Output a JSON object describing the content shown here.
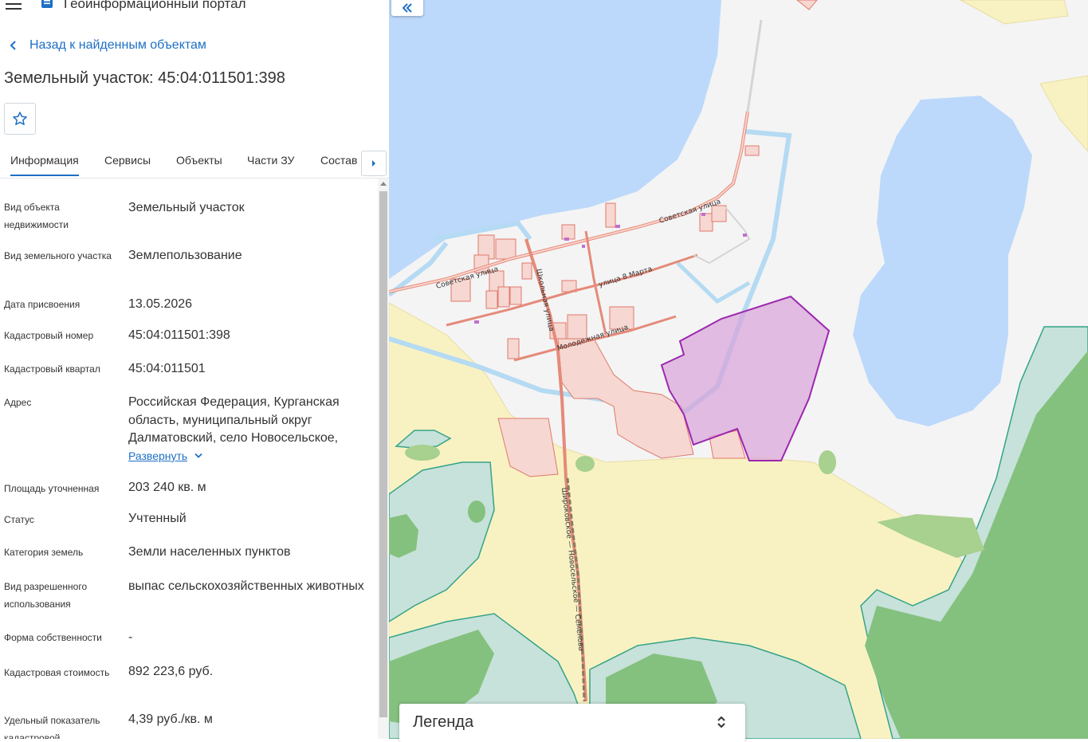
{
  "header": {
    "app_title": "Геоинформационный портал"
  },
  "back_link": {
    "label": "Назад к найденным объектам"
  },
  "page_title": "Земельный участок: 45:04:011501:398",
  "tabs": [
    {
      "label": "Информация",
      "active": true
    },
    {
      "label": "Сервисы"
    },
    {
      "label": "Объекты"
    },
    {
      "label": "Части ЗУ"
    },
    {
      "label": "Состав"
    }
  ],
  "properties": {
    "object_type": {
      "label": "Вид объекта недвижимости",
      "value": "Земельный участок"
    },
    "land_type": {
      "label": "Вид земельного участка",
      "value": "Землепользование"
    },
    "assigned_date": {
      "label": "Дата присвоения",
      "value": "13.05.2026"
    },
    "cadastral_number": {
      "label": "Кадастровый номер",
      "value": "45:04:011501:398"
    },
    "cadastral_quarter": {
      "label": "Кадастровый квартал",
      "value": "45:04:011501"
    },
    "address": {
      "label": "Адрес",
      "value": "Российская Федерация, Курганская область, муниципальный округ Далматовский, село Новосельское,",
      "expand": "Развернуть"
    },
    "area": {
      "label": "Площадь уточненная",
      "value": "203 240 кв. м"
    },
    "status": {
      "label": "Статус",
      "value": "Учтенный"
    },
    "land_category": {
      "label": "Категория земель",
      "value": "Земли населенных пунктов"
    },
    "permitted_use": {
      "label": "Вид разрешенного использования",
      "value": "выпас сельскохозяйственных животных"
    },
    "ownership": {
      "label": "Форма собственности",
      "value": "-"
    },
    "cadastral_value": {
      "label": "Кадастровая стоимость",
      "value": "892 223,6 руб."
    },
    "specific_value": {
      "label": "Удельный показатель кадастровой",
      "value": "4,39 руб./кв. м"
    }
  },
  "map": {
    "streets": {
      "sovetskaya": "Советская улица",
      "sovetskaya_w": "Советская улица",
      "march8": "улица 8 Марта",
      "shkolnaya": "Школьная улица",
      "molodezhnaya": "Молодежная улица",
      "road": "Широковское — Новосельское — Семенова"
    },
    "colors": {
      "water": "#bcd9fb",
      "forest": "#84c17f",
      "wetland": "#c7e2da",
      "field": "#f8f2c3",
      "selected_parcel": "#9c27b0",
      "parcel": "#e07a6a"
    }
  },
  "legend": {
    "title": "Легенда"
  }
}
